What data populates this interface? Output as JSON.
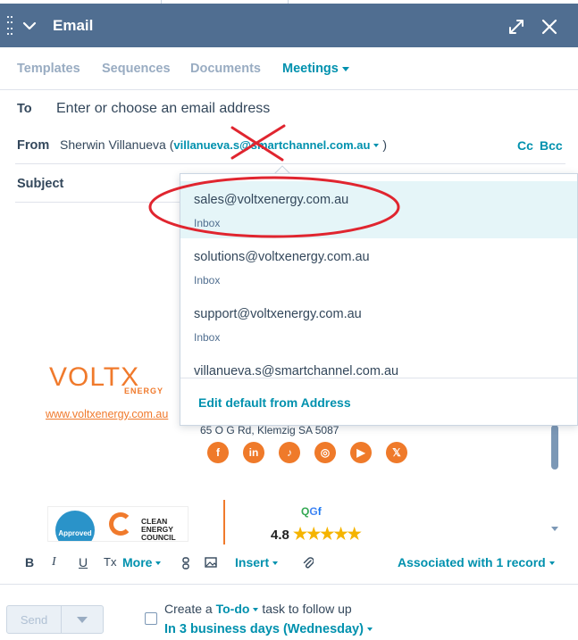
{
  "header": {
    "title": "Email"
  },
  "tabs": [
    {
      "label": "Templates"
    },
    {
      "label": "Sequences"
    },
    {
      "label": "Documents"
    },
    {
      "label": "Meetings"
    }
  ],
  "to": {
    "label": "To",
    "placeholder": "Enter or choose an email address"
  },
  "from": {
    "label": "From",
    "name": "Sherwin Villanueva (",
    "address": "villanueva.s@smartchannel.com.au",
    "close_paren": ")",
    "cc": "Cc",
    "bcc": "Bcc"
  },
  "subject": {
    "label": "Subject"
  },
  "from_dropdown": {
    "options": [
      {
        "email": "sales@voltxenergy.com.au",
        "type": "Inbox"
      },
      {
        "email": "solutions@voltxenergy.com.au",
        "type": "Inbox"
      },
      {
        "email": "support@voltxenergy.com.au",
        "type": "Inbox"
      },
      {
        "email": "villanueva.s@smartchannel.com.au"
      }
    ],
    "edit_default": "Edit default from Address"
  },
  "signature": {
    "logo_text": "VOLTX",
    "logo_sub": "ENERGY",
    "url": "www.voltxenergy.com.au",
    "address": "65 O G Rd, Klemzig SA 5087",
    "socials": [
      "facebook-icon",
      "linkedin-icon",
      "tiktok-icon",
      "instagram-icon",
      "youtube-icon",
      "x-icon"
    ],
    "badge_approved": "Approved",
    "badge_cec": [
      "CLEAN",
      "ENERGY",
      "COUNCIL"
    ],
    "rating": "4.8",
    "stars": "★★★★★"
  },
  "toolbar": {
    "bold": "B",
    "italic": "I",
    "underline": "U",
    "clear_format": "Tx",
    "more": "More",
    "insert": "Insert",
    "associated": "Associated with 1 record"
  },
  "footer": {
    "send": "Send",
    "create_a": "Create a",
    "todo": "To-do",
    "task_follow": "task to follow up",
    "due": "In 3 business days (Wednesday)"
  },
  "colors": {
    "header_bg": "#506e91",
    "accent": "#0091ae",
    "brand_orange": "#f07a2c",
    "annotation_red": "#e0252f"
  }
}
